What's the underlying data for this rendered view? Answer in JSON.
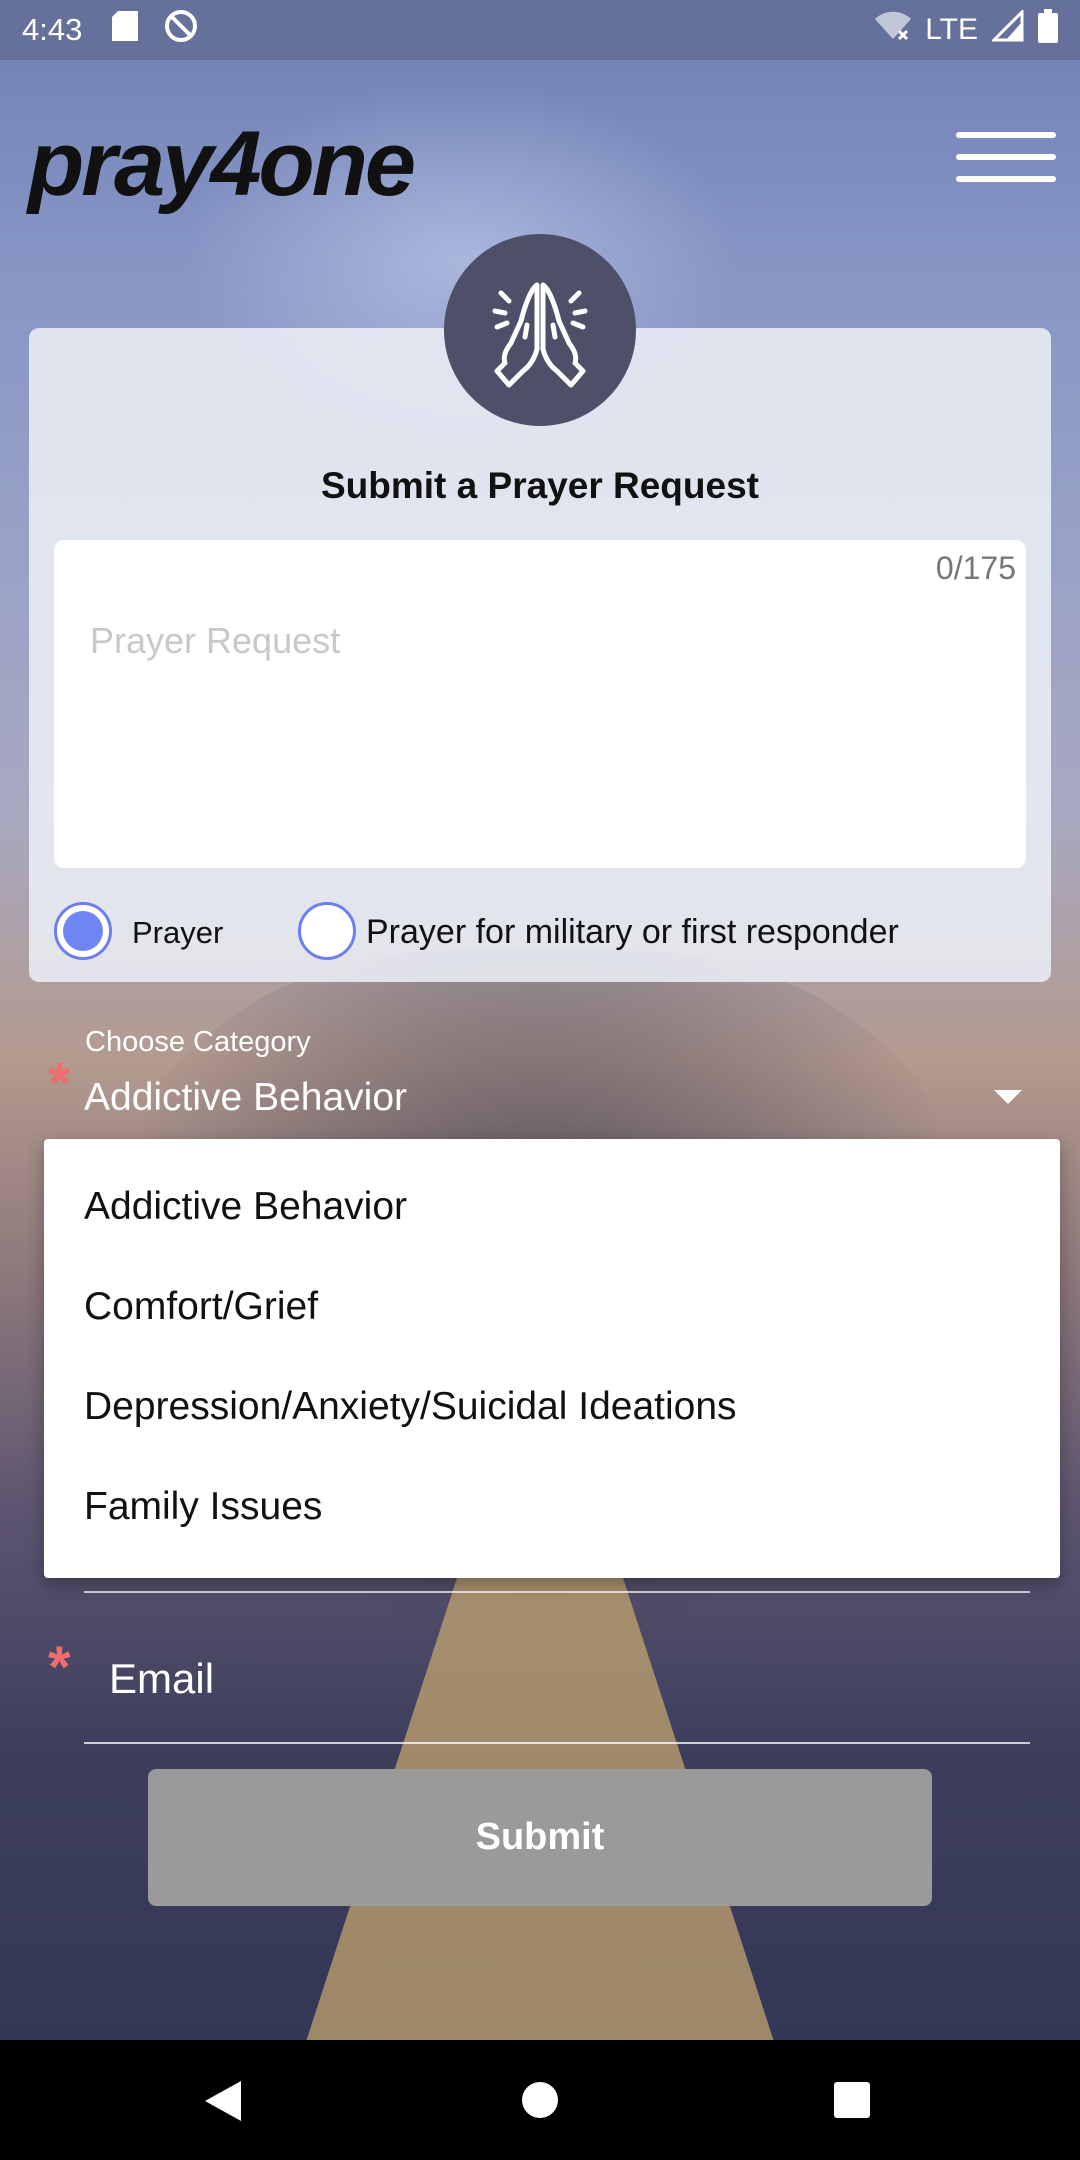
{
  "status_bar": {
    "time": "4:43",
    "network": "LTE",
    "icons": [
      "sd-card-icon",
      "do-not-disturb-icon",
      "wifi-off-icon",
      "signal-icon",
      "battery-icon"
    ]
  },
  "header": {
    "logo": "pray4one",
    "menu_icon": "hamburger-menu-icon"
  },
  "card": {
    "icon": "praying-hands-icon",
    "title": "Submit a Prayer Request",
    "textarea": {
      "counter": "0/175",
      "placeholder": "Prayer Request",
      "value": ""
    },
    "radios": [
      {
        "label": "Prayer",
        "checked": true
      },
      {
        "label": "Prayer for military or first responder",
        "checked": false
      }
    ]
  },
  "category": {
    "label": "Choose Category",
    "selected": "Addictive Behavior",
    "required_mark": "*",
    "options": [
      "Addictive Behavior",
      "Comfort/Grief",
      "Depression/Anxiety/Suicidal Ideations",
      "Family Issues"
    ]
  },
  "email": {
    "placeholder": "Email",
    "required_mark": "*"
  },
  "submit_label": "Submit",
  "colors": {
    "accent": "#6f86f2",
    "required": "#f06d6d",
    "submit_disabled": "#9a9a9a",
    "avatar_bg": "#4d5068"
  },
  "nav": {
    "back": "back-icon",
    "home": "home-icon",
    "recents": "recents-icon"
  }
}
